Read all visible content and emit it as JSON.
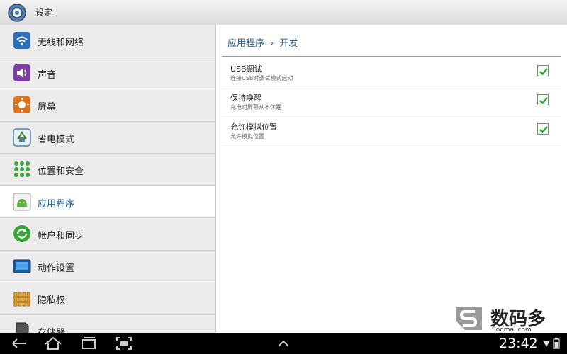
{
  "header": {
    "title": "设定",
    "icon": "gear-icon"
  },
  "sidebar": {
    "items": [
      {
        "label": "无线和网络",
        "icon": "wifi-icon"
      },
      {
        "label": "声音",
        "icon": "speaker-icon"
      },
      {
        "label": "屏幕",
        "icon": "brightness-icon"
      },
      {
        "label": "省电模式",
        "icon": "recycle-icon"
      },
      {
        "label": "位置和安全",
        "icon": "dots-grid-icon"
      },
      {
        "label": "应用程序",
        "icon": "android-icon",
        "active": true
      },
      {
        "label": "帐户和同步",
        "icon": "sync-icon"
      },
      {
        "label": "动作设置",
        "icon": "monitor-icon"
      },
      {
        "label": "隐私权",
        "icon": "fence-icon"
      },
      {
        "label": "存储器",
        "icon": "sdcard-icon"
      }
    ]
  },
  "main": {
    "breadcrumb": {
      "parent": "应用程序",
      "separator": "›",
      "current": "开发"
    },
    "options": [
      {
        "title": "USB调试",
        "subtitle": "连接USB时调试模式启动",
        "checked": true
      },
      {
        "title": "保持唤醒",
        "subtitle": "充电时屏幕从不休眠",
        "checked": true
      },
      {
        "title": "允许模拟位置",
        "subtitle": "允许模拟位置",
        "checked": true
      }
    ]
  },
  "watermark": {
    "text_cn": "数码多",
    "text_en": "Soomal.com"
  },
  "system_bar": {
    "clock": "23:42",
    "buttons": [
      "back-icon",
      "home-icon",
      "recent-apps-icon",
      "screenshot-icon",
      "up-chevron-icon"
    ]
  },
  "colors": {
    "accent": "#1e5e8c",
    "checkmark": "#2e9a2e"
  }
}
